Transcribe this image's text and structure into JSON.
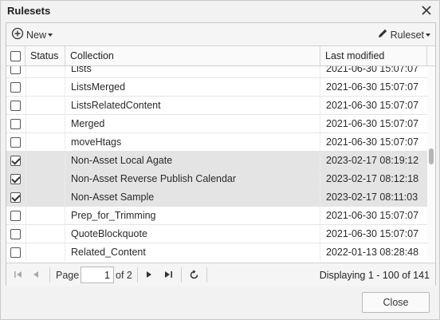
{
  "dialog": {
    "title": "Rulesets"
  },
  "toolbar": {
    "new_label": "New",
    "ruleset_label": "Ruleset"
  },
  "grid": {
    "columns": {
      "status": "Status",
      "collection": "Collection",
      "last_modified": "Last modified"
    },
    "rows": [
      {
        "collection": "Lists",
        "modified": "2021-06-30 15:07:07",
        "checked": false
      },
      {
        "collection": "ListsMerged",
        "modified": "2021-06-30 15:07:07",
        "checked": false
      },
      {
        "collection": "ListsRelatedContent",
        "modified": "2021-06-30 15:07:07",
        "checked": false
      },
      {
        "collection": "Merged",
        "modified": "2021-06-30 15:07:07",
        "checked": false
      },
      {
        "collection": "moveHtags",
        "modified": "2021-06-30 15:07:07",
        "checked": false
      },
      {
        "collection": "Non-Asset Local Agate",
        "modified": "2023-02-17 08:19:12",
        "checked": true
      },
      {
        "collection": "Non-Asset Reverse Publish Calendar",
        "modified": "2023-02-17 08:12:18",
        "checked": true
      },
      {
        "collection": "Non-Asset Sample",
        "modified": "2023-02-17 08:11:03",
        "checked": true
      },
      {
        "collection": "Prep_for_Trimming",
        "modified": "2021-06-30 15:07:07",
        "checked": false
      },
      {
        "collection": "QuoteBlockquote",
        "modified": "2021-06-30 15:07:07",
        "checked": false
      },
      {
        "collection": "Related_Content",
        "modified": "2022-01-13 08:28:48",
        "checked": false
      },
      {
        "collection": "",
        "modified": "",
        "checked": false
      }
    ]
  },
  "pager": {
    "page_label": "Page",
    "page_value": "1",
    "of_label": "of 2",
    "display_text": "Displaying 1 - 100 of 141"
  },
  "footer": {
    "close_label": "Close"
  },
  "icons": {
    "new": "plus-circle-icon",
    "ruleset": "pencil-icon",
    "close": "close-icon",
    "first": "first-page-icon",
    "prev": "prev-page-icon",
    "next": "next-page-icon",
    "last": "last-page-icon",
    "refresh": "refresh-icon"
  }
}
